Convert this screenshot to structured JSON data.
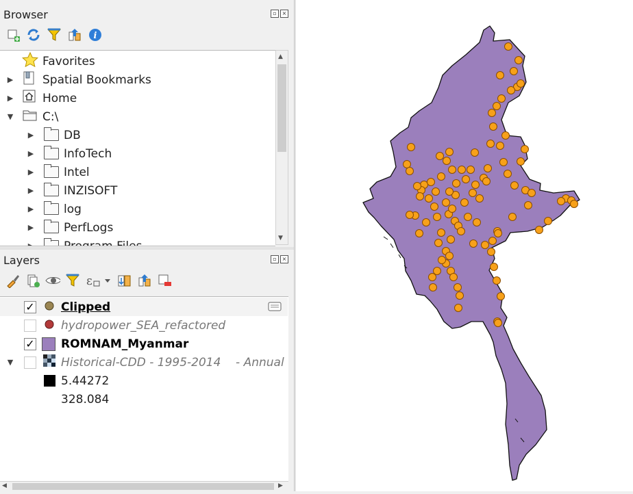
{
  "browser": {
    "title": "Browser",
    "items": [
      {
        "label": "Favorites",
        "expander": ""
      },
      {
        "label": "Spatial Bookmarks",
        "expander": "▶"
      },
      {
        "label": "Home",
        "expander": "▶"
      },
      {
        "label": "C:\\",
        "expander": "▼"
      },
      {
        "label": "DB",
        "expander": "▶"
      },
      {
        "label": "InfoTech",
        "expander": "▶"
      },
      {
        "label": "Intel",
        "expander": "▶"
      },
      {
        "label": "INZISOFT",
        "expander": "▶"
      },
      {
        "label": "log",
        "expander": "▶"
      },
      {
        "label": "PerfLogs",
        "expander": "▶"
      },
      {
        "label": "Program Files",
        "expander": "▶"
      }
    ]
  },
  "layers": {
    "title": "Layers",
    "items": [
      {
        "label": "Clipped",
        "checked": "✓",
        "symbol_color": "#9a8552"
      },
      {
        "label": "hydropower_SEA_refactored",
        "checked": "",
        "symbol_color": "#b33a3a"
      },
      {
        "label": "ROMNAM_Myanmar",
        "checked": "✓",
        "symbol_color": "#9b7fbc"
      },
      {
        "label": "Historical-CDD - 1995-2014    - Annual",
        "checked": ""
      }
    ],
    "legend": {
      "min": "5.44272",
      "max": "328.084"
    }
  },
  "colors": {
    "polygon_fill": "#9b7fbc",
    "point_fill": "#f7a11a",
    "point_stroke": "#8a4c00"
  },
  "points": [
    [
      742,
      68
    ],
    [
      757,
      88
    ],
    [
      730,
      110
    ],
    [
      750,
      104
    ],
    [
      755,
      127
    ],
    [
      760,
      122
    ],
    [
      746,
      132
    ],
    [
      732,
      144
    ],
    [
      725,
      155
    ],
    [
      718,
      165
    ],
    [
      720,
      185
    ],
    [
      738,
      198
    ],
    [
      716,
      210
    ],
    [
      730,
      213
    ],
    [
      766,
      218
    ],
    [
      760,
      236
    ],
    [
      741,
      254
    ],
    [
      751,
      271
    ],
    [
      767,
      278
    ],
    [
      776,
      282
    ],
    [
      771,
      300
    ],
    [
      826,
      290
    ],
    [
      834,
      293
    ],
    [
      838,
      298
    ],
    [
      819,
      294
    ],
    [
      787,
      336
    ],
    [
      800,
      323
    ],
    [
      748,
      317
    ],
    [
      726,
      338
    ],
    [
      719,
      352
    ],
    [
      708,
      358
    ],
    [
      717,
      368
    ],
    [
      721,
      390
    ],
    [
      725,
      410
    ],
    [
      731,
      433
    ],
    [
      726,
      470
    ],
    [
      600,
      215
    ],
    [
      594,
      240
    ],
    [
      598,
      250
    ],
    [
      619,
      270
    ],
    [
      629,
      266
    ],
    [
      636,
      280
    ],
    [
      644,
      258
    ],
    [
      652,
      235
    ],
    [
      660,
      248
    ],
    [
      674,
      248
    ],
    [
      680,
      262
    ],
    [
      694,
      270
    ],
    [
      706,
      260
    ],
    [
      712,
      246
    ],
    [
      690,
      282
    ],
    [
      678,
      296
    ],
    [
      665,
      285
    ],
    [
      651,
      296
    ],
    [
      655,
      313
    ],
    [
      664,
      323
    ],
    [
      644,
      340
    ],
    [
      640,
      355
    ],
    [
      638,
      317
    ],
    [
      634,
      302
    ],
    [
      615,
      278
    ],
    [
      626,
      290
    ],
    [
      660,
      305
    ],
    [
      669,
      330
    ],
    [
      673,
      338
    ],
    [
      683,
      317
    ],
    [
      696,
      325
    ],
    [
      700,
      290
    ],
    [
      710,
      265
    ],
    [
      687,
      248
    ],
    [
      666,
      268
    ],
    [
      656,
      280
    ],
    [
      658,
      350
    ],
    [
      651,
      367
    ],
    [
      651,
      385
    ],
    [
      658,
      396
    ],
    [
      662,
      405
    ],
    [
      668,
      420
    ],
    [
      671,
      432
    ],
    [
      669,
      450
    ],
    [
      656,
      374
    ],
    [
      645,
      380
    ],
    [
      638,
      396
    ],
    [
      631,
      405
    ],
    [
      632,
      420
    ],
    [
      606,
      315
    ],
    [
      612,
      341
    ],
    [
      622,
      325
    ],
    [
      598,
      314
    ],
    [
      613,
      287
    ],
    [
      609,
      272
    ],
    [
      691,
      356
    ],
    [
      693,
      223
    ],
    [
      656,
      222
    ],
    [
      642,
      228
    ],
    [
      735,
      237
    ],
    [
      727,
      341
    ],
    [
      727,
      472
    ]
  ]
}
